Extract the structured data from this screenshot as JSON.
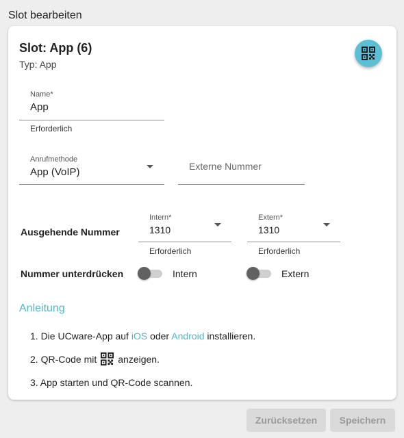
{
  "page": {
    "title": "Slot bearbeiten"
  },
  "slot": {
    "title": "Slot: App (6)",
    "type": "Typ: App",
    "qr_button_icon": "qr-code-icon"
  },
  "name_field": {
    "label": "Name*",
    "value": "App",
    "hint": "Erforderlich"
  },
  "call_method": {
    "label": "Anrufmethode",
    "value": "App (VoIP)"
  },
  "external_number": {
    "placeholder": "Externe Nummer"
  },
  "outgoing": {
    "label": "Ausgehende Nummer",
    "intern": {
      "label": "Intern*",
      "value": "1310",
      "hint": "Erforderlich"
    },
    "extern": {
      "label": "Extern*",
      "value": "1310",
      "hint": "Erforderlich"
    }
  },
  "suppress": {
    "label": "Nummer unterdrücken",
    "intern_label": "Intern",
    "extern_label": "Extern",
    "intern_on": false,
    "extern_on": false
  },
  "guide": {
    "heading": "Anleitung",
    "step1": {
      "prefix": "1. Die UCware-App auf",
      "link1": "iOS",
      "middle": "oder",
      "link2": "Android",
      "suffix": "installieren."
    },
    "step2": {
      "prefix": "2. QR-Code mit",
      "suffix": "anzeigen."
    },
    "step3": "3. App starten und QR-Code scannen."
  },
  "actions": {
    "reset": "Zurücksetzen",
    "save": "Speichern"
  },
  "colors": {
    "accent": "#5bc0d6",
    "link": "#4fb7cc",
    "disabled_button": "#dadada"
  }
}
